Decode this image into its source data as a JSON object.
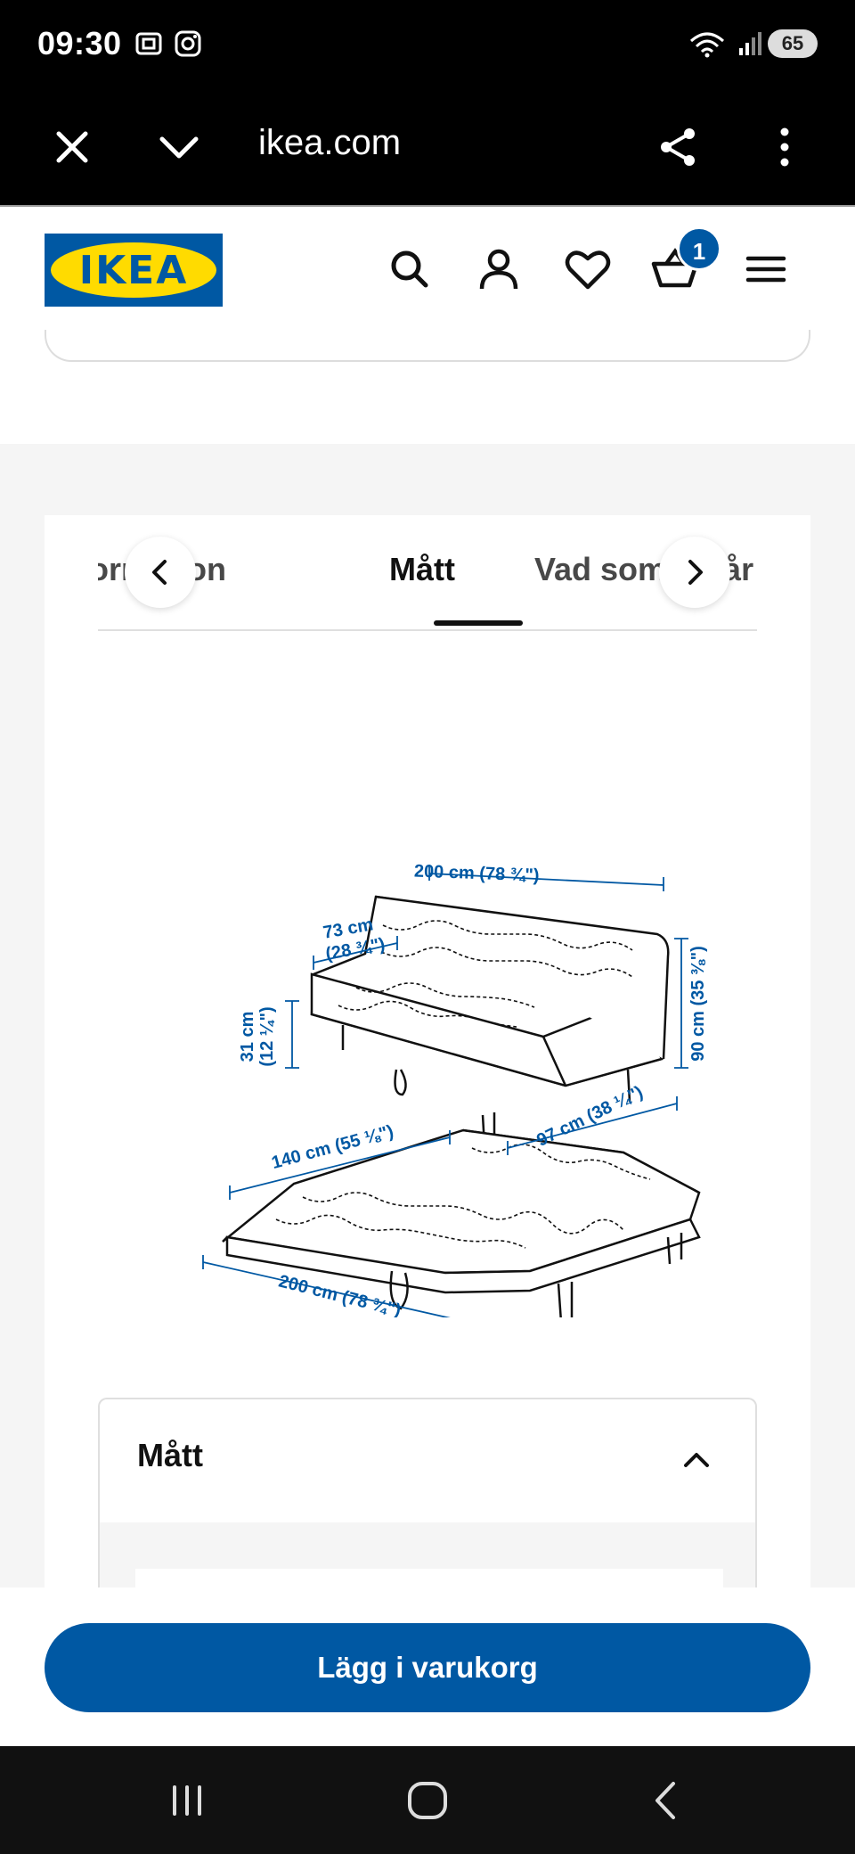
{
  "status": {
    "time": "09:30",
    "battery": "65"
  },
  "browser": {
    "url": "ikea.com"
  },
  "header": {
    "logo": "IKEA",
    "cart_count": "1"
  },
  "tabs": [
    {
      "label": "Produktinformation"
    },
    {
      "label": "Mått"
    },
    {
      "label": "Vad som ingår"
    }
  ],
  "diagram": {
    "sofa": {
      "width": "200 cm (78 ¾\")",
      "depth_a": "73 cm",
      "depth_b": "(28 ¾\")",
      "seat_height_a": "31 cm",
      "seat_height_b": "(12 ¼\")",
      "height": "90 cm (35 ⅜\")",
      "depth_total": "97 cm (38 ¼\")"
    },
    "bed": {
      "width": "140 cm (55 ⅛\")",
      "length": "200 cm (78 ¾\")"
    }
  },
  "accordion": {
    "title": "Mått"
  },
  "cta": {
    "label": "Lägg i varukorg"
  },
  "colors": {
    "brand_blue": "#0058a3",
    "brand_yellow": "#ffdb00"
  }
}
